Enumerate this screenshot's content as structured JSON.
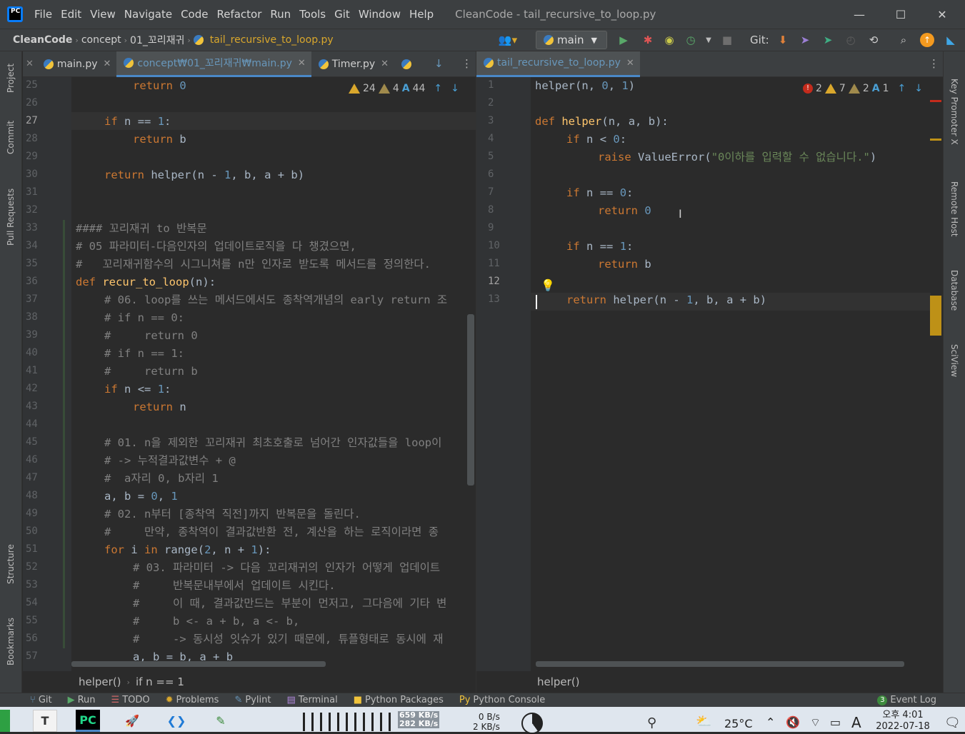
{
  "window": {
    "title": "CleanCode - tail_recursive_to_loop.py"
  },
  "menu": [
    "File",
    "Edit",
    "View",
    "Navigate",
    "Code",
    "Refactor",
    "Run",
    "Tools",
    "Git",
    "Window",
    "Help"
  ],
  "navbar": {
    "crumbs": [
      "CleanCode",
      "concept",
      "01_꼬리재귀",
      "tail_recursive_to_loop.py"
    ],
    "branch": "main",
    "git_label": "Git:"
  },
  "left_tabs": [
    {
      "label": "main.py"
    },
    {
      "label": "concept₩01_꼬리재귀₩main.py"
    },
    {
      "label": "Timer.py"
    }
  ],
  "right_tabs": [
    {
      "label": "tail_recursive_to_loop.py"
    }
  ],
  "left_inspect": {
    "warnings": "24",
    "weak": "4",
    "typos": "44"
  },
  "right_inspect": {
    "errors": "2",
    "warnings": "7",
    "weak": "2",
    "typos": "1"
  },
  "left_lines": [
    {
      "n": "25",
      "t": "return 0"
    },
    {
      "n": "26",
      "t": ""
    },
    {
      "n": "27",
      "t": "if n == 1:"
    },
    {
      "n": "28",
      "t": "return b"
    },
    {
      "n": "29",
      "t": ""
    },
    {
      "n": "30",
      "t": "return helper(n - 1, b, a + b)"
    },
    {
      "n": "31",
      "t": ""
    },
    {
      "n": "32",
      "t": ""
    },
    {
      "n": "33",
      "t": "#### 꼬리재귀 to 반복문"
    },
    {
      "n": "34",
      "t": "# 05 파라미터-다음인자의 업데이트로직을 다 챙겼으면,"
    },
    {
      "n": "35",
      "t": "#   꼬리재귀함수의 시그니쳐를 n만 인자로 받도록 메서드를 정의한다."
    },
    {
      "n": "36",
      "t": "def recur_to_loop(n):"
    },
    {
      "n": "37",
      "t": "# 06. loop를 쓰는 메서드에서도 종착역개념의 early return 조"
    },
    {
      "n": "38",
      "t": "# if n == 0:"
    },
    {
      "n": "39",
      "t": "#     return 0"
    },
    {
      "n": "40",
      "t": "# if n == 1:"
    },
    {
      "n": "41",
      "t": "#     return b"
    },
    {
      "n": "42",
      "t": "if n <= 1:"
    },
    {
      "n": "43",
      "t": "return n"
    },
    {
      "n": "44",
      "t": ""
    },
    {
      "n": "45",
      "t": "# 01. n을 제외한 꼬리재귀 최초호출로 넘어간 인자값들을 loop이"
    },
    {
      "n": "46",
      "t": "# -> 누적결과값변수 + @"
    },
    {
      "n": "47",
      "t": "#  a자리 0, b자리 1"
    },
    {
      "n": "48",
      "t": "a, b = 0, 1"
    },
    {
      "n": "49",
      "t": "# 02. n부터 [종착역 직전]까지 반복문을 돌린다."
    },
    {
      "n": "50",
      "t": "#     만약, 종착역이 결과값반환 전, 계산을 하는 로직이라면 종"
    },
    {
      "n": "51",
      "t": "for i in range(2, n + 1):"
    },
    {
      "n": "52",
      "t": "# 03. 파라미터 -> 다음 꼬리재귀의 인자가 어떻게 업데이트"
    },
    {
      "n": "53",
      "t": "#     반복문내부에서 업데이트 시킨다."
    },
    {
      "n": "54",
      "t": "#     이 때, 결과값만드는 부분이 먼저고, 그다음에 기타 변"
    },
    {
      "n": "55",
      "t": "#     b <- a + b, a <- b,"
    },
    {
      "n": "56",
      "t": "#     -> 동시성 잇슈가 있기 때문에, 튜플형태로 동시에 재"
    },
    {
      "n": "57",
      "t": "a, b = b, a + b"
    }
  ],
  "right_lines": [
    {
      "n": "1",
      "t": "helper(n, 0, 1)"
    },
    {
      "n": "2",
      "t": ""
    },
    {
      "n": "3",
      "t": "def helper(n, a, b):"
    },
    {
      "n": "4",
      "t": "if n < 0:"
    },
    {
      "n": "5",
      "t": "raise ValueError(\"0이하를 입력할 수 없습니다.\")"
    },
    {
      "n": "6",
      "t": ""
    },
    {
      "n": "7",
      "t": "if n == 0:"
    },
    {
      "n": "8",
      "t": "return 0"
    },
    {
      "n": "9",
      "t": ""
    },
    {
      "n": "10",
      "t": "if n == 1:"
    },
    {
      "n": "11",
      "t": "return b"
    },
    {
      "n": "12",
      "t": ""
    },
    {
      "n": "13",
      "t": "return helper(n - 1, b, a + b)"
    }
  ],
  "left_breadcrumb": [
    "helper()",
    "if n == 1"
  ],
  "right_breadcrumb": [
    "helper()"
  ],
  "left_strip": [
    "Project",
    "Commit",
    "Pull Requests",
    "Structure",
    "Bookmarks"
  ],
  "right_strip": [
    "Key Promoter X",
    "Remote Host",
    "Database",
    "SciView"
  ],
  "bottom_tools": [
    "Git",
    "Run",
    "TODO",
    "Problems",
    "Pylint",
    "Terminal",
    "Python Packages",
    "Python Console"
  ],
  "event_log": {
    "count": "3",
    "label": "Event Log"
  },
  "taskbar": {
    "net_up": "659 KB/s",
    "net_down": "282 KB/s",
    "disk_a": "0 B/s",
    "disk_b": "2 KB/s",
    "temp": "25°C",
    "ime": "A",
    "time": "오후 4:01",
    "date": "2022-07-18"
  }
}
